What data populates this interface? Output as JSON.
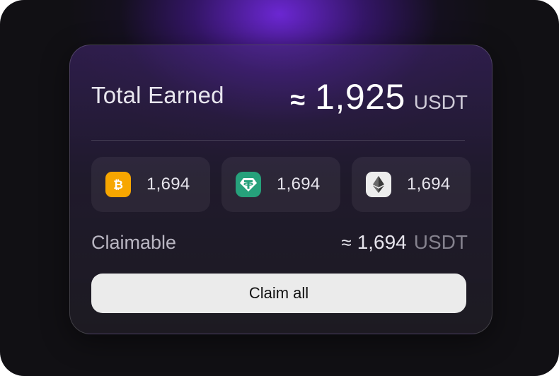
{
  "card": {
    "total_label": "Total Earned",
    "total_approx": "≈",
    "total_amount": "1,925",
    "total_unit": "USDT"
  },
  "coins": [
    {
      "icon": "bitcoin-icon",
      "color": "#F7A600",
      "amount": "1,694"
    },
    {
      "icon": "tether-icon",
      "color": "#26A17B",
      "amount": "1,694"
    },
    {
      "icon": "ethereum-icon",
      "color": "#EDEDED",
      "amount": "1,694"
    }
  ],
  "claimable": {
    "label": "Claimable",
    "approx": "≈",
    "amount": "1,694",
    "unit": "USDT"
  },
  "actions": {
    "claim_all_label": "Claim all"
  },
  "colors": {
    "background": "#111014",
    "glow": "#7028DC",
    "button": "#EBEBEB"
  }
}
